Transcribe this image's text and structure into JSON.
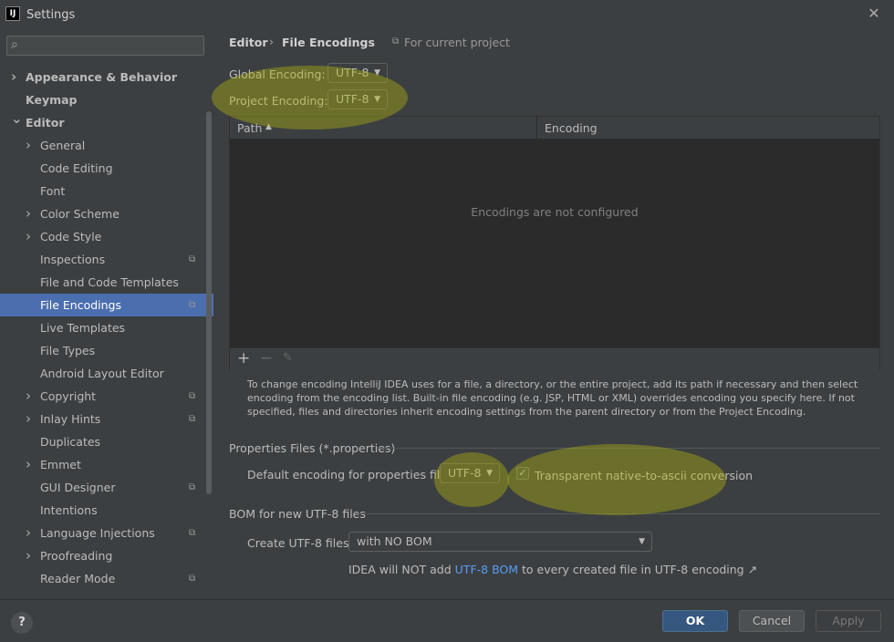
{
  "window": {
    "title": "Settings",
    "logo": "IJ"
  },
  "search": {
    "placeholder": ""
  },
  "sidebar": {
    "items": [
      {
        "label": "Appearance & Behavior",
        "expandable": true,
        "bold": true,
        "level": 0
      },
      {
        "label": "Keymap",
        "expandable": false,
        "bold": true,
        "level": 0
      },
      {
        "label": "Editor",
        "expandable": true,
        "expanded": true,
        "bold": true,
        "level": 0
      },
      {
        "label": "General",
        "expandable": true,
        "level": 1
      },
      {
        "label": "Code Editing",
        "level": 1
      },
      {
        "label": "Font",
        "level": 1
      },
      {
        "label": "Color Scheme",
        "expandable": true,
        "level": 1
      },
      {
        "label": "Code Style",
        "expandable": true,
        "level": 1
      },
      {
        "label": "Inspections",
        "level": 1,
        "project_icon": true
      },
      {
        "label": "File and Code Templates",
        "level": 1
      },
      {
        "label": "File Encodings",
        "level": 1,
        "project_icon": true,
        "selected": true
      },
      {
        "label": "Live Templates",
        "level": 1
      },
      {
        "label": "File Types",
        "level": 1
      },
      {
        "label": "Android Layout Editor",
        "level": 1
      },
      {
        "label": "Copyright",
        "expandable": true,
        "level": 1,
        "project_icon": true
      },
      {
        "label": "Inlay Hints",
        "expandable": true,
        "level": 1,
        "project_icon": true
      },
      {
        "label": "Duplicates",
        "level": 1
      },
      {
        "label": "Emmet",
        "expandable": true,
        "level": 1
      },
      {
        "label": "GUI Designer",
        "level": 1,
        "project_icon": true
      },
      {
        "label": "Intentions",
        "level": 1
      },
      {
        "label": "Language Injections",
        "expandable": true,
        "level": 1,
        "project_icon": true
      },
      {
        "label": "Proofreading",
        "expandable": true,
        "level": 1
      },
      {
        "label": "Reader Mode",
        "level": 1,
        "project_icon": true
      }
    ]
  },
  "breadcrumb": {
    "parent": "Editor",
    "separator": "›",
    "current": "File Encodings",
    "scope": "For current project"
  },
  "global_encoding": {
    "label": "Global Encoding:",
    "value": "UTF-8"
  },
  "project_encoding": {
    "label": "Project Encoding:",
    "value": "UTF-8"
  },
  "table": {
    "columns": [
      "Path",
      "Encoding"
    ],
    "empty_text": "Encodings are not configured",
    "toolbar": {
      "add": "+",
      "remove": "−",
      "edit": "✎"
    }
  },
  "help_text": "To change encoding IntelliJ IDEA uses for a file, a directory, or the entire project, add its path if necessary and then select encoding from the encoding list. Built-in file encoding (e.g. JSP, HTML or XML) overrides encoding you specify here. If not specified, files and directories inherit encoding settings from the parent directory or from the Project Encoding.",
  "properties": {
    "section_title": "Properties Files (*.properties)",
    "default_label": "Default encoding for properties files:",
    "default_value": "UTF-8",
    "native_label": "Transparent native-to-ascii conversion",
    "native_checked": true
  },
  "bom": {
    "section_title": "BOM for new UTF-8 files",
    "create_label": "Create UTF-8 files:",
    "create_value": "with NO BOM",
    "note_prefix": "IDEA will NOT add ",
    "note_link": "UTF-8 BOM",
    "note_suffix": " to every created file in UTF-8 encoding ↗"
  },
  "footer": {
    "help": "?",
    "ok": "OK",
    "cancel": "Cancel",
    "apply": "Apply"
  },
  "colors": {
    "accent": "#4b6eaf",
    "link": "#589df6",
    "highlight": "#b4b90a"
  }
}
